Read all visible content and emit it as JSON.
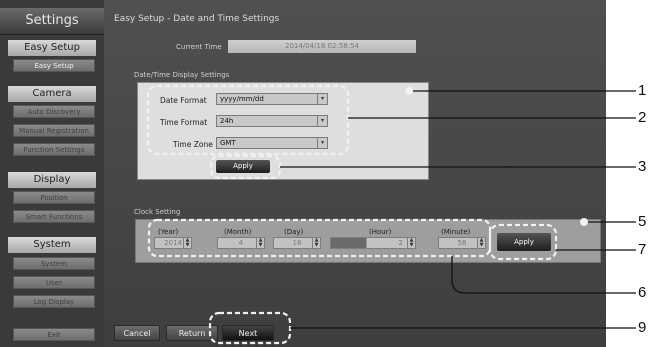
{
  "sidebar": {
    "title": "Settings",
    "sections": [
      {
        "header": "Easy Setup",
        "items": [
          "Easy Setup"
        ]
      },
      {
        "header": "Camera",
        "items": [
          "Auto Discovery",
          "Manual Registration",
          "Function Settings"
        ]
      },
      {
        "header": "Display",
        "items": [
          "Position",
          "Smart Functions"
        ]
      },
      {
        "header": "System",
        "items": [
          "System",
          "User",
          "Log Display"
        ]
      }
    ],
    "exit_label": "Exit"
  },
  "main": {
    "title": "Easy Setup - Date and Time Settings",
    "current_time_label": "Current Time",
    "current_time_value": "2014/04/18 02:58:54"
  },
  "display_settings": {
    "section_label": "Date/Time Display Settings",
    "date_format_label": "Date Format",
    "date_format_value": "yyyy/mm/dd",
    "time_format_label": "Time Format",
    "time_format_value": "24h",
    "time_zone_label": "Time Zone",
    "time_zone_value": "GMT",
    "apply_label": "Apply"
  },
  "clock_setting": {
    "section_label": "Clock Setting",
    "year_label": "(Year)",
    "year_value": "2014",
    "month_label": "(Month)",
    "month_value": "4",
    "day_label": "(Day)",
    "day_value": "18",
    "hour_label": "(Hour)",
    "hour_value": "2",
    "minute_label": "(Minute)",
    "minute_value": "58",
    "apply_label": "Apply"
  },
  "footer": {
    "cancel_label": "Cancel",
    "return_label": "Return",
    "next_label": "Next"
  },
  "callouts": [
    "1",
    "2",
    "3",
    "5",
    "7",
    "6",
    "9"
  ],
  "colors": {
    "screen_bg": "#474747",
    "panel_bg": "#dedede",
    "highlight": "#f0f0f0"
  }
}
